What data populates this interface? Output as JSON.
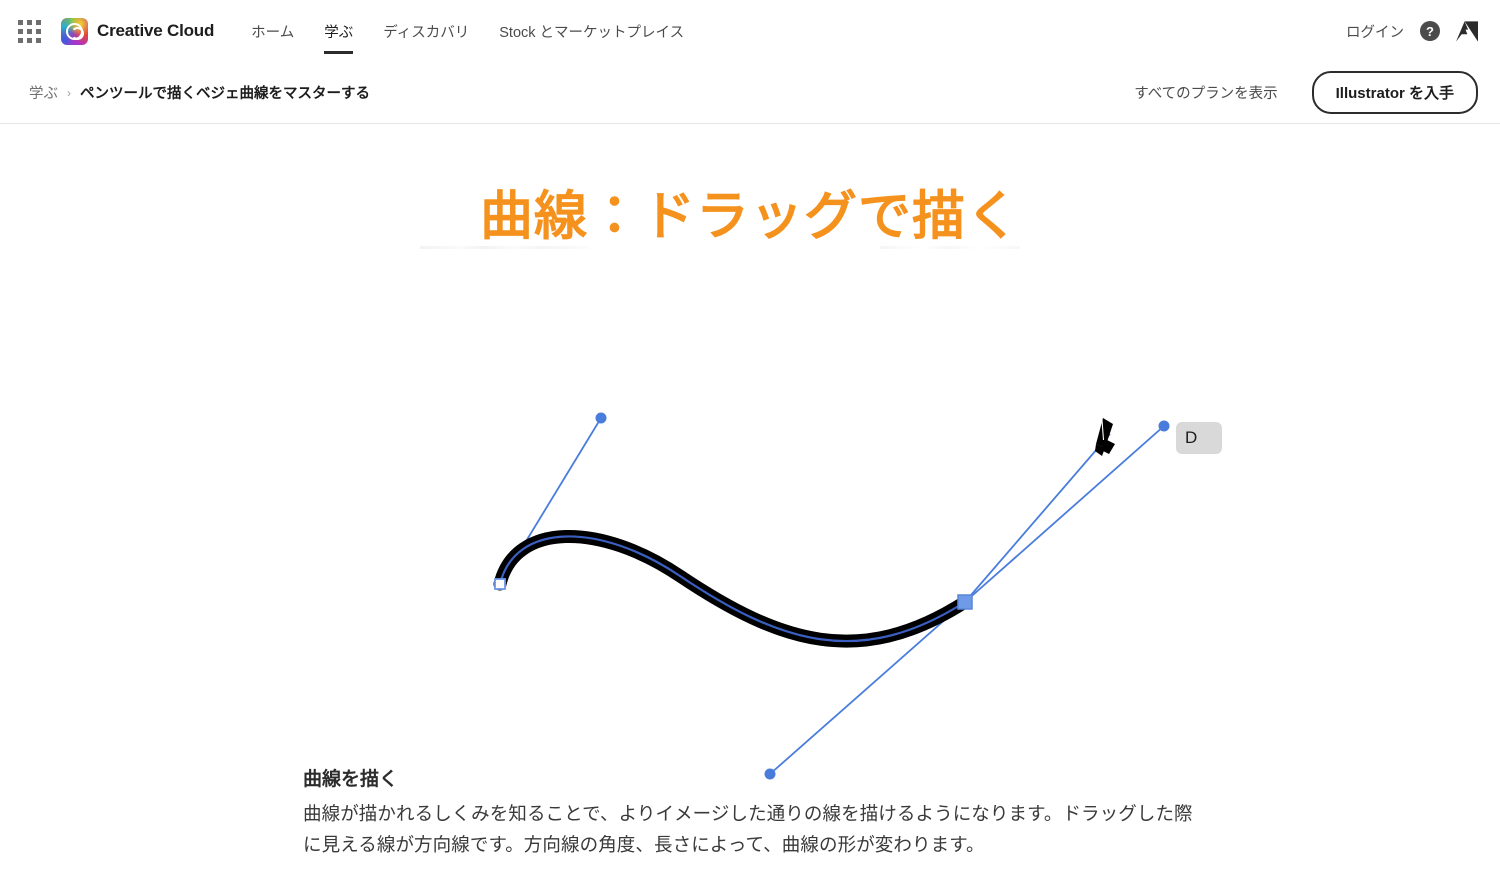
{
  "global_nav": {
    "app_grid_icon": "app-grid-icon",
    "brand": {
      "logo_icon": "creative-cloud-logo-icon",
      "name": "Creative Cloud"
    },
    "links": [
      {
        "label": "ホーム",
        "active": false
      },
      {
        "label": "学ぶ",
        "active": true
      },
      {
        "label": "ディスカバリ",
        "active": false
      },
      {
        "label": "Stock とマーケットプレイス",
        "active": false
      }
    ],
    "login_label": "ログイン",
    "help_icon": "help-circle-icon",
    "help_glyph": "?",
    "adobe_logo_icon": "adobe-logo-icon"
  },
  "subnav": {
    "breadcrumb": {
      "parent": "学ぶ",
      "separator": "›",
      "current": "ペンツールで描くベジェ曲線をマスターする"
    },
    "plans_label": "すべてのプランを表示",
    "cta_label": "Illustrator を入手"
  },
  "slide": {
    "title": "曲線：ドラッグで描く",
    "title_color": "#F5921E",
    "pen_badge_text": "D",
    "pen_cursor_icon": "pen-tool-cursor-icon",
    "path_stroke_color": "#000000",
    "selection_color": "#4a7ddb",
    "anchor_fill_selected": "#6f9ae8",
    "anchor_fill_unselected": "#ffffff"
  },
  "caption": {
    "heading": "曲線を描く",
    "body": "曲線が描かれるしくみを知ることで、よりイメージした通りの線を描けるようになります。ドラッグした際に見える線が方向線です。方向線の角度、長さによって、曲線の形が変わります。"
  }
}
